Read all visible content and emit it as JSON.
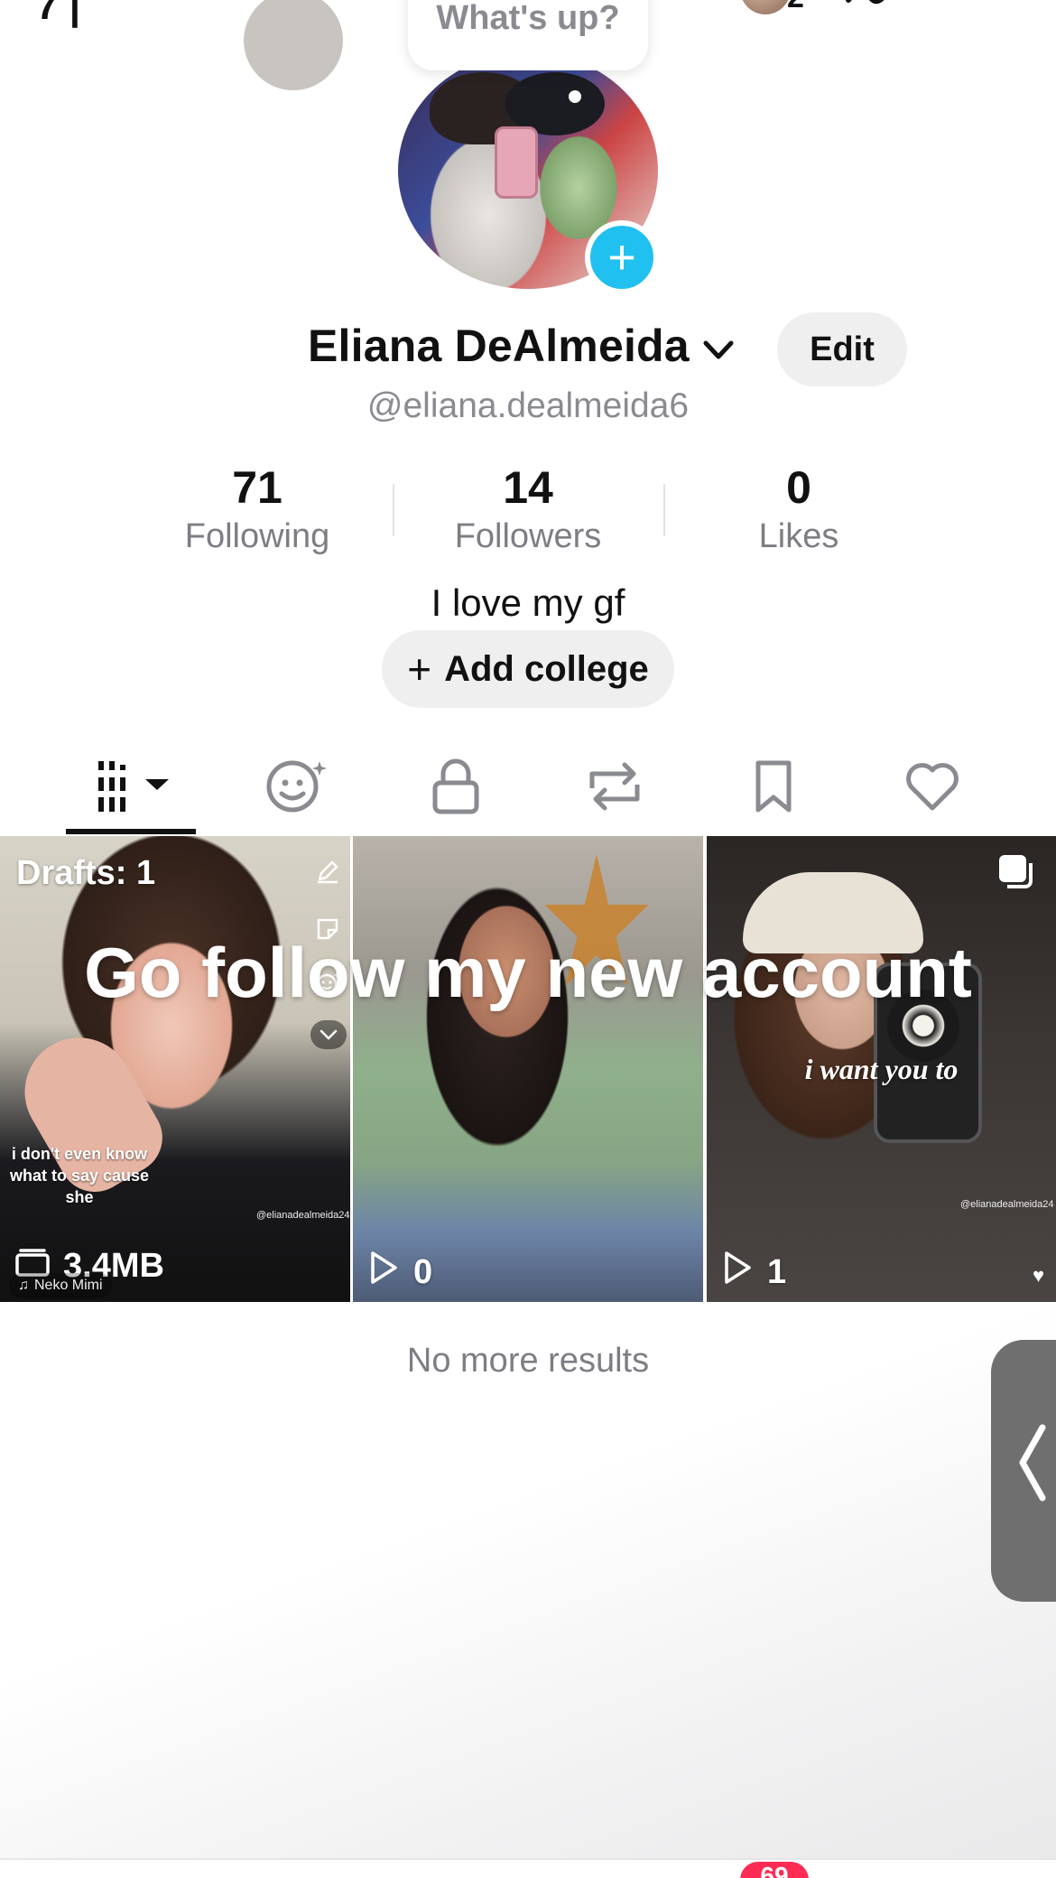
{
  "status_bar": {
    "count": "2"
  },
  "profile": {
    "bubble_text": "What's up?",
    "name": "Eliana DeAlmeida",
    "edit_label": "Edit",
    "handle": "@eliana.dealmeida6",
    "bio": "I love my gf",
    "add_college_label": "Add college"
  },
  "stats": [
    {
      "value": "71",
      "label": "Following"
    },
    {
      "value": "14",
      "label": "Followers"
    },
    {
      "value": "0",
      "label": "Likes"
    }
  ],
  "tabs": [
    {
      "icon": "grid-icon",
      "active": true
    },
    {
      "icon": "favorite-creators-icon"
    },
    {
      "icon": "lock-icon"
    },
    {
      "icon": "repost-icon"
    },
    {
      "icon": "bookmark-icon"
    },
    {
      "icon": "heart-icon"
    }
  ],
  "videos": [
    {
      "drafts_label": "Drafts: 1",
      "caption": "i don't even know what to say cause she",
      "watermark": "@elianadealmeida24",
      "size": "3.4MB",
      "music": "Neko Mimi"
    },
    {
      "views": "0"
    },
    {
      "views": "1",
      "caption": "i want you to",
      "watermark": "@elianadealmeida24"
    }
  ],
  "overlay_text": "Go follow my new account",
  "footer": {
    "no_more": "No more results",
    "badge": "69"
  },
  "colors": {
    "accent_blue": "#20c0f0",
    "badge_red": "#fe2c55",
    "muted_text": "#8a8b91"
  }
}
